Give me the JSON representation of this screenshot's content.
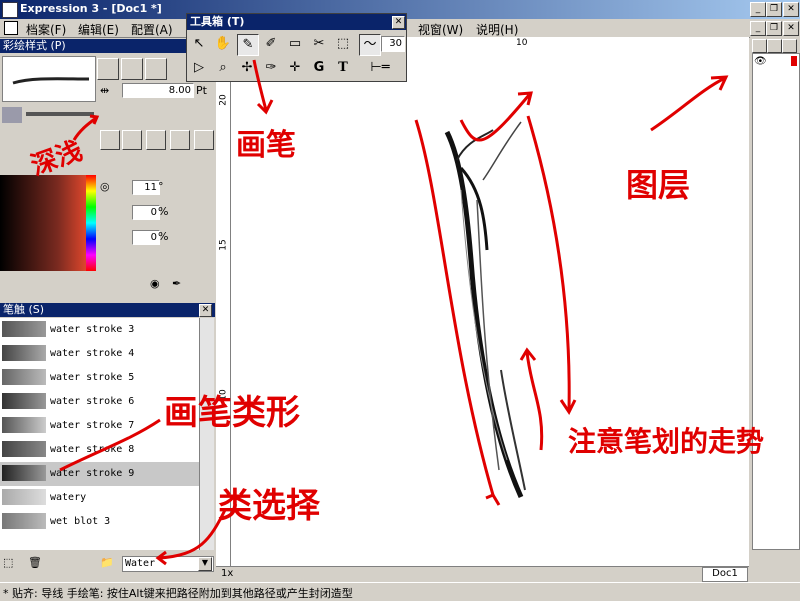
{
  "window": {
    "title": "Expression 3 - [Doc1 *]"
  },
  "menu": {
    "items": [
      "档案(F)",
      "编辑(E)",
      "配置(A)",
      "视窗(W)",
      "说明(H)"
    ]
  },
  "toolbox": {
    "title": "工具箱 (T)",
    "stroke_width": "30",
    "tools_row1": [
      "pointer-icon",
      "hand-icon",
      "brush-icon",
      "eyedropper-icon",
      "rectangle-icon",
      "scissors-icon",
      "marquee-icon"
    ],
    "tools_row2": [
      "subselect-icon",
      "zoom-icon",
      "node-icon",
      "pen-icon",
      "add-point-icon",
      "G",
      "T"
    ]
  },
  "style_panel": {
    "title": "彩绘样式 (P)",
    "width_value": "8.00",
    "width_unit": "Pt",
    "hue_value": "11",
    "hue_unit": "°",
    "sat_value": "0",
    "sat_unit": "%",
    "light_value": "0",
    "light_unit": "%"
  },
  "stroke_panel": {
    "title": "笔触 (S)",
    "items": [
      {
        "label": "water stroke 3",
        "selected": false
      },
      {
        "label": "water stroke 4",
        "selected": false
      },
      {
        "label": "water stroke 5",
        "selected": false
      },
      {
        "label": "water stroke 6",
        "selected": false
      },
      {
        "label": "water stroke 7",
        "selected": false
      },
      {
        "label": "water stroke 8",
        "selected": false
      },
      {
        "label": "water stroke 9",
        "selected": true
      },
      {
        "label": "watery",
        "selected": false
      },
      {
        "label": "wet blot 3",
        "selected": false
      }
    ],
    "category": "Water"
  },
  "ruler": {
    "top_marks": [
      "10"
    ],
    "left_marks": [
      "20",
      "15",
      "10"
    ]
  },
  "zoom": "1x",
  "doc_tab": "Doc1",
  "status": {
    "text": "* 贴齐: 导线    手绘笔: 按住Alt键来把路径附加到其他路径或产生封闭造型"
  },
  "annotations": {
    "brush": "画笔",
    "layer": "图层",
    "depth": "深浅",
    "brush_shape": "画笔类形",
    "category_select": "类选择",
    "stroke_trend": "注意笔划的走势"
  },
  "colors": {
    "annotation": "#e00000",
    "titlebar": "#0a246a"
  }
}
